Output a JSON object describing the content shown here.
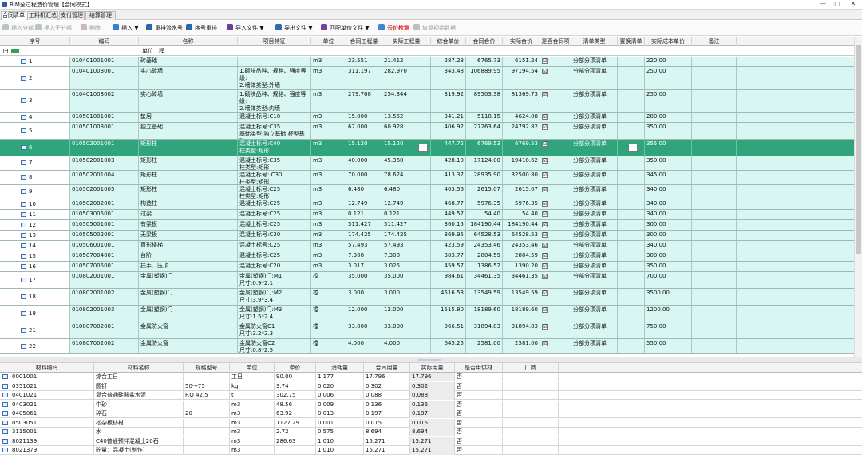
{
  "window": {
    "title": "BIM全过程造价管理【合同模式】",
    "controls": [
      "—",
      "□",
      "✕"
    ]
  },
  "tabs": [
    "合同清单",
    "工料机汇总",
    "支付管理",
    "结算管理"
  ],
  "toolbar": [
    {
      "label": "插入分部",
      "disabled": true,
      "icon": "insert-division-icon",
      "color": "#b9c9b9"
    },
    {
      "label": "插入子分部",
      "disabled": true,
      "icon": "insert-subdivision-icon",
      "color": "#b9c9b9"
    },
    {
      "label": "删除",
      "disabled": true,
      "icon": "delete-icon",
      "color": "#c9b9b9"
    },
    {
      "label": "插入 ▼",
      "disabled": false,
      "icon": "insert-icon",
      "color": "#3a7dc8"
    },
    {
      "label": "重排流水号",
      "disabled": false,
      "icon": "renumber-icon",
      "color": "#2c65ad"
    },
    {
      "label": "序号重排",
      "disabled": false,
      "icon": "resort-icon",
      "color": "#2c65ad"
    },
    {
      "label": "导入文件 ▼",
      "disabled": false,
      "icon": "import-file-icon",
      "color": "#6e3d99"
    },
    {
      "label": "导出文件 ▼",
      "disabled": false,
      "icon": "export-file-icon",
      "color": "#2f6ab7"
    },
    {
      "label": "匹配单价文件 ▼",
      "disabled": false,
      "icon": "match-price-icon",
      "color": "#7a3f9c"
    },
    {
      "label": "云价检测",
      "disabled": false,
      "red": true,
      "icon": "cloud-price-icon",
      "color": "#3c87d4"
    },
    {
      "label": "恢复初始数据",
      "disabled": true,
      "icon": "restore-icon",
      "color": "#c9b9b9"
    }
  ],
  "columns": [
    "序号",
    "编码",
    "名称",
    "项目特征",
    "单位",
    "合同工程量",
    "实际工程量",
    "综合单价",
    "合同合价",
    "实际合价",
    "是否合同项",
    "清单类型",
    "置换清单",
    "实际成本单价",
    "备注"
  ],
  "group_label": "单位工程",
  "rows": [
    {
      "no": "1",
      "code": "010401001001",
      "name": "砖基础",
      "feature": "",
      "unit": "m3",
      "cq": "23.551",
      "aq": "21.412",
      "price": "287.28",
      "ctotal": "6765.73",
      "atotal": "6151.24",
      "contract": "☑",
      "type": "分部分项清单",
      "cost": "220.00"
    },
    {
      "no": "2",
      "code": "010401003001",
      "name": "实心砖墙",
      "feature": "1.砌块品种、规格、强度等级:\n2.墙体类型:外墙\n3.砂浆强度等级:M7.5水泥砂浆",
      "unit": "m3",
      "cq": "311.197",
      "aq": "282.970",
      "price": "343.48",
      "ctotal": "106889.95",
      "atotal": "97194.54",
      "contract": "☑",
      "type": "分部分项清单",
      "cost": "250.00"
    },
    {
      "no": "3",
      "code": "010401003002",
      "name": "实心砖墙",
      "feature": "1.砌块品种、规格、强度等级:\n2.墙体类型:内墙\n3.砂浆强度等级:M7.5水泥砂浆",
      "unit": "m3",
      "cq": "279.768",
      "aq": "254.344",
      "price": "319.92",
      "ctotal": "89503.38",
      "atotal": "81369.73",
      "contract": "☑",
      "type": "分部分项清单",
      "cost": "250.00"
    },
    {
      "no": "4",
      "code": "010501001001",
      "name": "垫层",
      "feature": "混凝土标号:C10",
      "unit": "m3",
      "cq": "15.000",
      "aq": "13.552",
      "price": "341.21",
      "ctotal": "5118.15",
      "atotal": "4624.08",
      "contract": "☑",
      "type": "分部分项清单",
      "cost": "280.00"
    },
    {
      "no": "5",
      "code": "010501003001",
      "name": "独立基础",
      "feature": "混凝土标号:C35\n基础类型:独立基础,杯型基础",
      "unit": "m3",
      "cq": "67.000",
      "aq": "60.928",
      "price": "406.92",
      "ctotal": "27263.64",
      "atotal": "24792.82",
      "contract": "☑",
      "type": "分部分项清单",
      "cost": "350.00"
    },
    {
      "no": "6",
      "code": "010502001001",
      "name": "矩形柱",
      "feature": "混凝土标号:C40\n柱类型:矩形",
      "unit": "m3",
      "cq": "15.120",
      "aq": "15.120",
      "price": "447.72",
      "ctotal": "6769.53",
      "atotal": "6769.53",
      "contract": "☑",
      "type": "分部分项清单",
      "cost": "355.00",
      "selected": true
    },
    {
      "no": "7",
      "code": "010502001003",
      "name": "矩形柱",
      "feature": "混凝土标号:C35\n柱类型:矩形",
      "unit": "m3",
      "cq": "40.000",
      "aq": "45.360",
      "price": "428.10",
      "ctotal": "17124.00",
      "atotal": "19418.62",
      "contract": "☑",
      "type": "分部分项清单",
      "cost": "350.00"
    },
    {
      "no": "8",
      "code": "010502001004",
      "name": "矩形柱",
      "feature": "混凝土标号: C30\n柱类型:矩形",
      "unit": "m3",
      "cq": "70.000",
      "aq": "78.624",
      "price": "413.37",
      "ctotal": "28935.90",
      "atotal": "32500.80",
      "contract": "☑",
      "type": "分部分项清单",
      "cost": "345.00"
    },
    {
      "no": "9",
      "code": "010502001005",
      "name": "矩形柱",
      "feature": "混凝土标号:C25\n柱类型:矩形",
      "unit": "m3",
      "cq": "6.480",
      "aq": "6.480",
      "price": "403.56",
      "ctotal": "2615.07",
      "atotal": "2615.07",
      "contract": "☑",
      "type": "分部分项清单",
      "cost": "340.00"
    },
    {
      "no": "10",
      "code": "010502002001",
      "name": "构造柱",
      "feature": "混凝土标号:C25",
      "unit": "m3",
      "cq": "12.749",
      "aq": "12.749",
      "price": "468.77",
      "ctotal": "5976.35",
      "atotal": "5976.35",
      "contract": "☑",
      "type": "分部分项清单",
      "cost": "340.00"
    },
    {
      "no": "11",
      "code": "010503005001",
      "name": "过梁",
      "feature": "混凝土标号:C25",
      "unit": "m3",
      "cq": "0.121",
      "aq": "0.121",
      "price": "449.57",
      "ctotal": "54.40",
      "atotal": "54.40",
      "contract": "☑",
      "type": "分部分项清单",
      "cost": "340.00"
    },
    {
      "no": "12",
      "code": "010505001001",
      "name": "有梁板",
      "feature": "混凝土标号:C25",
      "unit": "m3",
      "cq": "511.427",
      "aq": "511.427",
      "price": "360.15",
      "ctotal": "184190.44",
      "atotal": "184190.44",
      "contract": "☑",
      "type": "分部分项清单",
      "cost": "300.00"
    },
    {
      "no": "13",
      "code": "010505002001",
      "name": "无梁板",
      "feature": "混凝土标号:C30",
      "unit": "m3",
      "cq": "174.425",
      "aq": "174.425",
      "price": "369.95",
      "ctotal": "64528.53",
      "atotal": "64528.53",
      "contract": "☑",
      "type": "分部分项清单",
      "cost": "300.00"
    },
    {
      "no": "14",
      "code": "010506001001",
      "name": "直形楼梯",
      "feature": "混凝土标号:C25",
      "unit": "m3",
      "cq": "57.493",
      "aq": "57.493",
      "price": "423.59",
      "ctotal": "24353.46",
      "atotal": "24353.46",
      "contract": "☑",
      "type": "分部分项清单",
      "cost": "340.00"
    },
    {
      "no": "15",
      "code": "010507004001",
      "name": "台阶",
      "feature": "混凝土标号:C25",
      "unit": "m3",
      "cq": "7.308",
      "aq": "7.308",
      "price": "383.77",
      "ctotal": "2804.59",
      "atotal": "2804.59",
      "contract": "☑",
      "type": "分部分项清单",
      "cost": "300.00"
    },
    {
      "no": "16",
      "code": "010507005001",
      "name": "扶手、压顶",
      "feature": "混凝土标号:C20",
      "unit": "m3",
      "cq": "3.017",
      "aq": "3.025",
      "price": "459.57",
      "ctotal": "1386.52",
      "atotal": "1390.20",
      "contract": "☑",
      "type": "分部分项清单",
      "cost": "350.00"
    },
    {
      "no": "17",
      "code": "010802001001",
      "name": "金属(塑钢)门",
      "feature": "金属(塑钢)门:M1\n尺寸:0.9*2.1",
      "unit": "樘",
      "cq": "35.000",
      "aq": "35.000",
      "price": "984.61",
      "ctotal": "34461.35",
      "atotal": "34461.35",
      "contract": "☑",
      "type": "分部分项清单",
      "cost": "700.00"
    },
    {
      "no": "18",
      "code": "010802001002",
      "name": "金属(塑钢)门",
      "feature": "金属(塑钢)门:M2\n尺寸:3.9*3.4",
      "unit": "樘",
      "cq": "3.000",
      "aq": "3.000",
      "price": "4516.53",
      "ctotal": "13549.59",
      "atotal": "13549.59",
      "contract": "☑",
      "type": "分部分项清单",
      "cost": "3500.00"
    },
    {
      "no": "19",
      "code": "010802001003",
      "name": "金属(塑钢)门",
      "feature": "金属(塑钢)门:M3\n尺寸:1.5*2.4",
      "unit": "樘",
      "cq": "12.000",
      "aq": "12.000",
      "price": "1515.80",
      "ctotal": "18189.60",
      "atotal": "18189.60",
      "contract": "☑",
      "type": "分部分项清单",
      "cost": "1200.00"
    },
    {
      "no": "21",
      "code": "010807002001",
      "name": "金属防火窗",
      "feature": "金属防火窗C1\n尺寸:3.2*2.3",
      "unit": "樘",
      "cq": "33.000",
      "aq": "33.000",
      "price": "966.51",
      "ctotal": "31894.83",
      "atotal": "31894.83",
      "contract": "☑",
      "type": "分部分项清单",
      "cost": "750.00"
    },
    {
      "no": "22",
      "code": "010807002002",
      "name": "金属防火窗",
      "feature": "金属防火窗C2\n尺寸:0.8*2.5",
      "unit": "樘",
      "cq": "4.000",
      "aq": "4.000",
      "price": "645.25",
      "ctotal": "2581.00",
      "atotal": "2581.00",
      "contract": "☑",
      "type": "分部分项清单",
      "cost": "550.00"
    }
  ],
  "materials_columns": [
    "材料编码",
    "材料名称",
    "规格型号",
    "单位",
    "单价",
    "消耗量",
    "合同用量",
    "实际用量",
    "是否甲供材",
    "厂商"
  ],
  "materials": [
    {
      "code": "0001001",
      "name": "综合工日",
      "spec": "",
      "unit": "工日",
      "price": "90.00",
      "cons": "1.177",
      "cq": "17.796",
      "aq": "17.796",
      "jia": "否"
    },
    {
      "code": "0351021",
      "name": "圆钉",
      "spec": "50～75",
      "unit": "kg",
      "price": "3.74",
      "cons": "0.020",
      "cq": "0.302",
      "aq": "0.302",
      "jia": "否"
    },
    {
      "code": "0401021",
      "name": "复合普通硅酸盐水泥",
      "spec": "P.O  42.5",
      "unit": "t",
      "price": "302.75",
      "cons": "0.006",
      "cq": "0.088",
      "aq": "0.088",
      "jia": "否"
    },
    {
      "code": "0403021",
      "name": "中砂",
      "spec": "",
      "unit": "m3",
      "price": "48.56",
      "cons": "0.009",
      "cq": "0.136",
      "aq": "0.136",
      "jia": "否"
    },
    {
      "code": "0405061",
      "name": "碎石",
      "spec": "20",
      "unit": "m3",
      "price": "63.92",
      "cons": "0.013",
      "cq": "0.197",
      "aq": "0.197",
      "jia": "否"
    },
    {
      "code": "0503051",
      "name": "松杂板枋材",
      "spec": "",
      "unit": "m3",
      "price": "1127.29",
      "cons": "0.001",
      "cq": "0.015",
      "aq": "0.015",
      "jia": "否"
    },
    {
      "code": "3115001",
      "name": "水",
      "spec": "",
      "unit": "m3",
      "price": "2.72",
      "cons": "0.575",
      "cq": "8.694",
      "aq": "8.694",
      "jia": "否"
    },
    {
      "code": "8021139",
      "name": "C40普通预拌混凝土20石",
      "spec": "",
      "unit": "m3",
      "price": "286.63",
      "cons": "1.010",
      "cq": "15.271",
      "aq": "15.271",
      "jia": "否"
    },
    {
      "code": "8021379",
      "name": "砼量：混凝土(制作)",
      "spec": "",
      "unit": "m3",
      "price": "",
      "cons": "1.010",
      "cq": "15.271",
      "aq": "15.271",
      "jia": "否"
    }
  ]
}
